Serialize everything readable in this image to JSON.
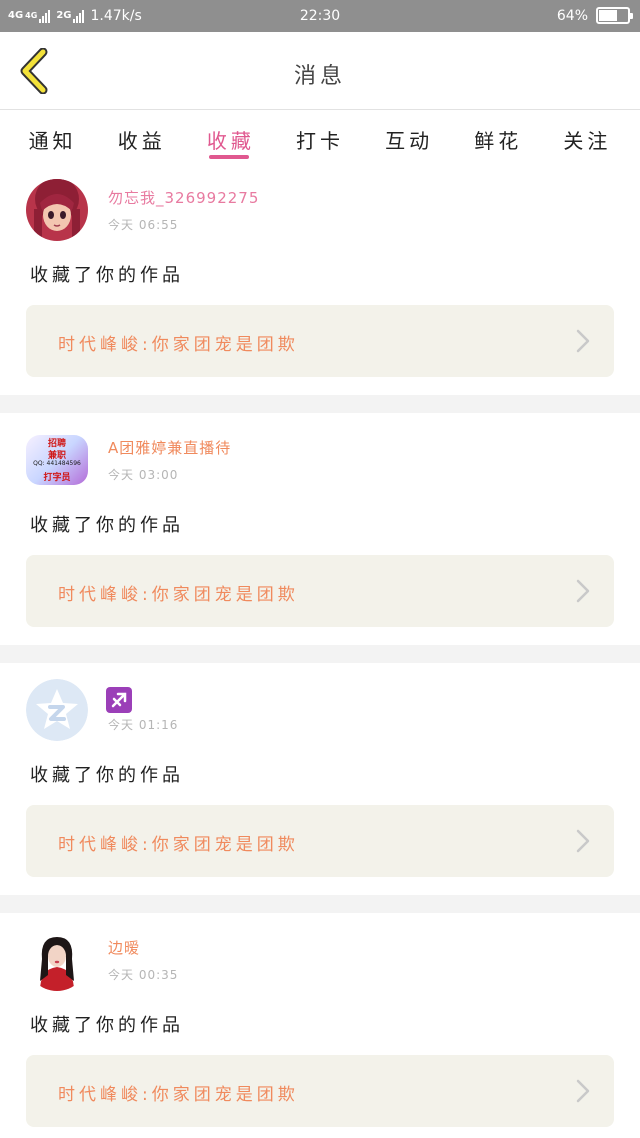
{
  "status_bar": {
    "network1": "4G",
    "network1_sub": "4G",
    "network2": "2G",
    "speed": "1.47k/s",
    "time": "22:30",
    "battery_text": "64%",
    "battery_level": 0.64
  },
  "nav": {
    "title": "消息",
    "back_icon": "chevron-left-icon"
  },
  "tabs": [
    {
      "label": "通知",
      "active": false
    },
    {
      "label": "收益",
      "active": false
    },
    {
      "label": "收藏",
      "active": true
    },
    {
      "label": "打卡",
      "active": false
    },
    {
      "label": "互动",
      "active": false
    },
    {
      "label": "鲜花",
      "active": false
    },
    {
      "label": "关注",
      "active": false
    }
  ],
  "colors": {
    "accent_pink": "#e0588f",
    "work_orange": "#f08a5d",
    "user_pink": "#e87aa0",
    "user_orange": "#f08a5d",
    "status_bar_bg": "#8f8f8f"
  },
  "messages": [
    {
      "user_name": "勿忘我_326992275",
      "time": "今天 06:55",
      "action": "收藏了你的作品",
      "work_title": "时代峰峻:你家团宠是团欺",
      "avatar": "anime-girl-avatar"
    },
    {
      "user_name": "A团雅婷兼直播待",
      "time": "今天 03:00",
      "action": "收藏了你的作品",
      "work_title": "时代峰峻:你家团宠是团欺",
      "avatar": "recruitment-ad-avatar",
      "avatar_text": [
        "招聘",
        "兼职",
        "QQ: 441484596",
        "打字员"
      ]
    },
    {
      "user_name": "",
      "time": "今天 01:16",
      "action": "收藏了你的作品",
      "work_title": "时代峰峻:你家团宠是团欺",
      "avatar": "qq-default-avatar",
      "name_icon": "sagittarius-icon"
    },
    {
      "user_name": "边暧",
      "time": "今天 00:35",
      "action": "收藏了你的作品",
      "work_title": "时代峰峻:你家团宠是团欺",
      "avatar": "girl-photo-avatar"
    }
  ]
}
